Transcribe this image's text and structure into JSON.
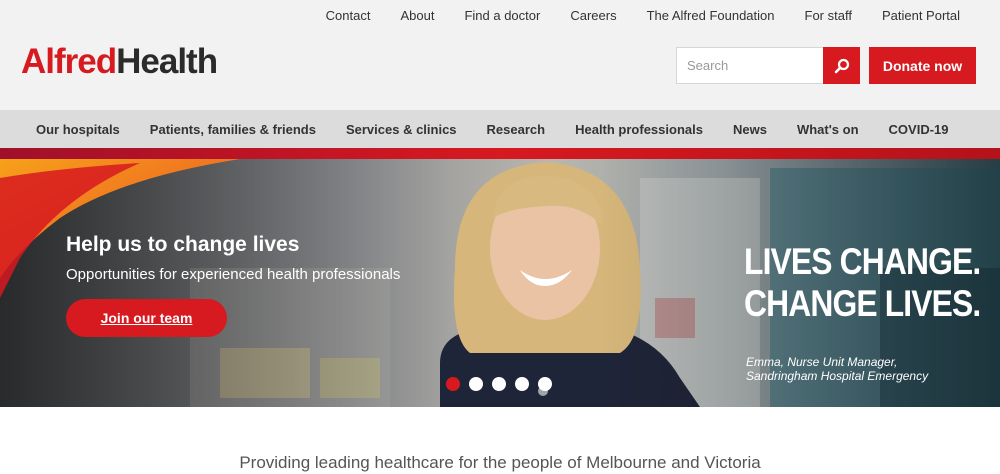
{
  "utility_nav": [
    "Contact",
    "About",
    "Find a doctor",
    "Careers",
    "The Alfred Foundation",
    "For staff",
    "Patient Portal"
  ],
  "logo": {
    "part1": "Alfred",
    "part2": "Health"
  },
  "search": {
    "placeholder": "Search",
    "icon": "search-icon"
  },
  "donate_label": "Donate now",
  "main_nav": [
    "Our hospitals",
    "Patients, families & friends",
    "Services & clinics",
    "Research",
    "Health professionals",
    "News",
    "What's on",
    "COVID-19"
  ],
  "hero": {
    "title": "Help us to change lives",
    "subtitle": "Opportunities for experienced health professionals",
    "cta": "Join our team",
    "slogan_line1": "LIVES CHANGE.",
    "slogan_line2": "CHANGE LIVES.",
    "caption_line1": "Emma, Nurse Unit Manager,",
    "caption_line2": "Sandringham Hospital Emergency",
    "carousel_count": 5,
    "carousel_active": 1
  },
  "tagline": "Providing leading healthcare for the people of Melbourne and Victoria",
  "colors": {
    "brand": "#d71920",
    "nav_bg": "#dcdcdc",
    "header_bg": "#f2f2f2"
  }
}
